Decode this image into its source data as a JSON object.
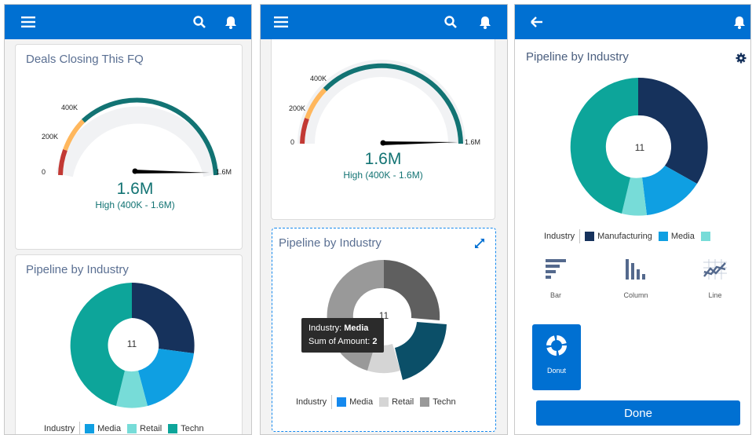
{
  "screen1": {
    "gauge_card": {
      "title": "Deals Closing This FQ",
      "ticks": [
        "0",
        "200K",
        "400K",
        "1.6M"
      ],
      "value": "1.6M",
      "range": "High (400K - 1.6M)"
    },
    "pipeline_card": {
      "title": "Pipeline by Industry",
      "center": "11",
      "legend_title": "Industry",
      "legend_items": [
        "Media",
        "Retail",
        "Techn"
      ]
    }
  },
  "screen2": {
    "gauge_card": {
      "ticks": [
        "0",
        "200K",
        "400K",
        "1.6M"
      ],
      "value": "1.6M",
      "range": "High (400K - 1.6M)"
    },
    "pipeline_card": {
      "title": "Pipeline by Industry",
      "center": "11",
      "tooltip": {
        "industry_label": "Industry:",
        "industry_value": "Media",
        "amount_label": "Sum of Amount:",
        "amount_value": "2"
      },
      "legend_title": "Industry",
      "legend_items": [
        "Media",
        "Retail",
        "Techn"
      ]
    }
  },
  "screen3": {
    "title": "Pipeline by Industry",
    "center": "11",
    "legend_title": "Industry",
    "legend_items": [
      "Manufacturing",
      "Media"
    ],
    "chart_types": [
      "Bar",
      "Column",
      "Line",
      "Donut"
    ],
    "done_label": "Done"
  },
  "colors": {
    "brand": "#0070d2",
    "manufacturing": "#16325c",
    "media": "#0f9fe2",
    "retail": "#77dcd8",
    "technology": "#0da59a",
    "gauge_red": "#c23934",
    "gauge_orange": "#ffb75d",
    "gauge_green": "#127373"
  },
  "icons": [
    "menu-icon",
    "search-icon",
    "bell-icon",
    "expand-icon",
    "back-arrow-icon",
    "gear-icon",
    "bar-chart-icon",
    "column-chart-icon",
    "line-chart-icon",
    "donut-chart-icon"
  ]
}
